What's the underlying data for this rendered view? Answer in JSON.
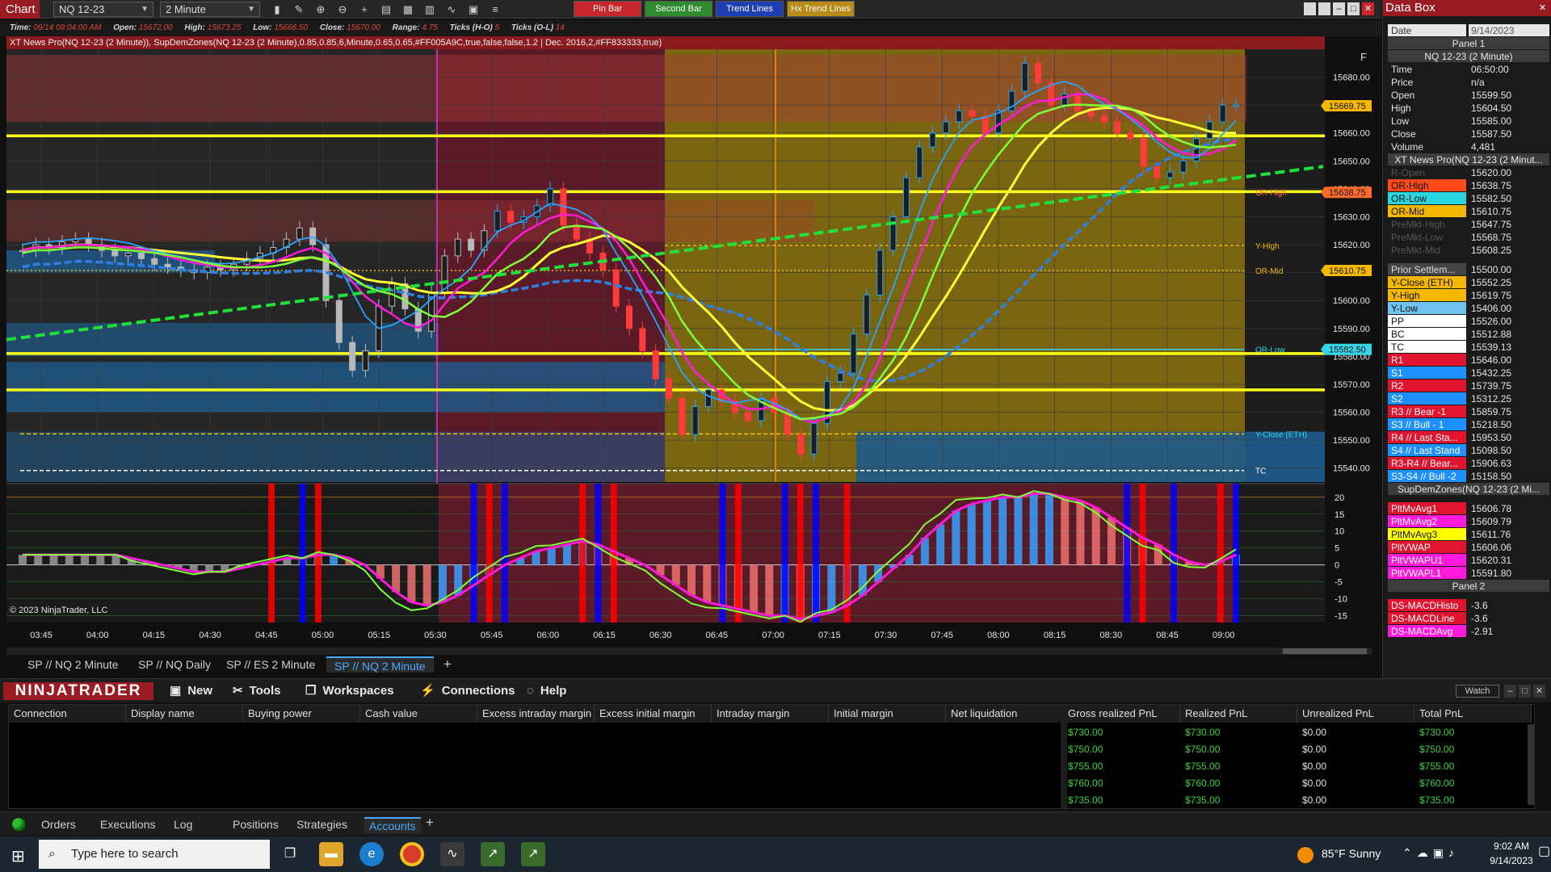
{
  "app": {
    "window_title": "Chart",
    "instrument": "NQ 12-23",
    "timeframe": "2 Minute",
    "copyright": "© 2023 NinjaTrader, LLC",
    "f_label": "F"
  },
  "highlight_buttons": [
    {
      "label": "Pin Bar",
      "color": "#c8262a"
    },
    {
      "label": "Second Bar",
      "color": "#2e8b2e"
    },
    {
      "label": "Trend Lines",
      "color": "#1d3fb3"
    },
    {
      "label": "Hx Trend Lines",
      "color": "#b88a18"
    }
  ],
  "info": {
    "time_label": "Time:",
    "time": "09/14 09:04:00 AM",
    "open_label": "Open:",
    "open": "15672.00",
    "high_label": "High:",
    "high": "15673.25",
    "low_label": "Low:",
    "low": "15668.50",
    "close_label": "Close:",
    "close": "15670.00",
    "range_label": "Range:",
    "range": "4.75",
    "ticks_hl_label": "Ticks (H-O)",
    "ticks_hl": "5",
    "ticks_ol_label": "Ticks (O-L)",
    "ticks_ol": "14"
  },
  "indicator_line": "XT News Pro(NQ 12-23 (2 Minute)), SupDemZones(NQ 12-23 (2 Minute),0.85,0.85,6,Minute,0.65,0.65,#FF005A9C,true,false,false,1.2 | Dec. 2016,2,#FF833333,true)",
  "price_axis": {
    "ticks": [
      "15680.00",
      "15670.00",
      "15660.00",
      "15650.00",
      "15640.00",
      "15630.00",
      "15620.00",
      "15610.00",
      "15600.00",
      "15590.00",
      "15580.00",
      "15570.00",
      "15560.00",
      "15550.00",
      "15540.00"
    ]
  },
  "price_markers": [
    {
      "value": "15669.75",
      "color": "#f5b800"
    },
    {
      "value": "15638.75",
      "color": "#ff6a2a"
    },
    {
      "value": "15610.75",
      "color": "#f5b800"
    },
    {
      "value": "15582.50",
      "color": "#34d6e6"
    }
  ],
  "level_labels": [
    "OR-High",
    "Y-High",
    "OR-Mid",
    "OR-Low",
    "Y-Close (ETH)",
    "TC"
  ],
  "macd_axis": {
    "ticks": [
      "20",
      "15",
      "10",
      "5",
      "0",
      "-5",
      "-10",
      "-15"
    ]
  },
  "time_axis": {
    "ticks": [
      "03:45",
      "04:00",
      "04:15",
      "04:30",
      "04:45",
      "05:00",
      "05:15",
      "05:30",
      "05:45",
      "06:00",
      "06:15",
      "06:30",
      "06:45",
      "07:00",
      "07:15",
      "07:30",
      "07:45",
      "08:00",
      "08:15",
      "08:30",
      "08:45",
      "09:00"
    ]
  },
  "chart_tabs": [
    {
      "label": "SP // NQ  2 Minute",
      "active": false
    },
    {
      "label": "SP // NQ  Daily",
      "active": false
    },
    {
      "label": "SP // ES  2 Minute",
      "active": false
    },
    {
      "label": "SP // NQ  2 Minute",
      "active": true
    }
  ],
  "add_tab": "+",
  "databox": {
    "title": "Data Box",
    "date_label": "Date",
    "date": "9/14/2023",
    "rows": [
      {
        "t": "sec",
        "k": "Panel 1"
      },
      {
        "t": "sec",
        "k": "NQ 12-23 (2 Minute)"
      },
      {
        "k": "Time",
        "v": "06:50:00",
        "bg": ""
      },
      {
        "k": "Price",
        "v": "n/a",
        "bg": ""
      },
      {
        "k": "Open",
        "v": "15599.50",
        "bg": ""
      },
      {
        "k": "High",
        "v": "15604.50",
        "bg": ""
      },
      {
        "k": "Low",
        "v": "15585.00",
        "bg": ""
      },
      {
        "k": "Close",
        "v": "15587.50",
        "bg": ""
      },
      {
        "k": "Volume",
        "v": "4,481",
        "bg": ""
      },
      {
        "t": "sec",
        "k": "XT News Pro(NQ 12-23 (2 Minut..."
      },
      {
        "k": "R-Open",
        "v": "15620.00",
        "bg": "#1a1a1a",
        "fg": "#555"
      },
      {
        "k": "OR-High",
        "v": "15638.75",
        "bg": "#ff4a1a",
        "fg": "#111"
      },
      {
        "k": "OR-Low",
        "v": "15582.50",
        "bg": "#2ad6e0",
        "fg": "#111"
      },
      {
        "k": "OR-Mid",
        "v": "15610.75",
        "bg": "#f5b800",
        "fg": "#111"
      },
      {
        "k": "PreMkt-High",
        "v": "15647.75",
        "bg": "#1a1a1a",
        "fg": "#555"
      },
      {
        "k": "PreMkt-Low",
        "v": "15568.75",
        "bg": "#1a1a1a",
        "fg": "#555"
      },
      {
        "k": "PreMkt-Mid",
        "v": "15608.25",
        "bg": "#1a1a1a",
        "fg": "#555"
      },
      {
        "t": "gap"
      },
      {
        "k": "Prior Settlem...",
        "v": "15500.00",
        "bg": "#444",
        "fg": "#ddd"
      },
      {
        "k": "Y-Close (ETH)",
        "v": "15552.25",
        "bg": "#f5b800",
        "fg": "#111"
      },
      {
        "k": "Y-High",
        "v": "15619.75",
        "bg": "#f5b800",
        "fg": "#111"
      },
      {
        "k": "Y-Low",
        "v": "15406.00",
        "bg": "#6fc3ef",
        "fg": "#111"
      },
      {
        "k": "PP",
        "v": "15526.00",
        "bg": "#ffffff",
        "fg": "#111"
      },
      {
        "k": "BC",
        "v": "15512.88",
        "bg": "#ffffff",
        "fg": "#111"
      },
      {
        "k": "TC",
        "v": "15539.13",
        "bg": "#ffffff",
        "fg": "#111"
      },
      {
        "k": "R1",
        "v": "15646.00",
        "bg": "#e0142e",
        "fg": "#fff"
      },
      {
        "k": "S1",
        "v": "15432.25",
        "bg": "#1e90ff",
        "fg": "#fff"
      },
      {
        "k": "R2",
        "v": "15739.75",
        "bg": "#e0142e",
        "fg": "#fff"
      },
      {
        "k": "S2",
        "v": "15312.25",
        "bg": "#1e90ff",
        "fg": "#fff"
      },
      {
        "k": "R3 // Bear -1",
        "v": "15859.75",
        "bg": "#e0142e",
        "fg": "#fff"
      },
      {
        "k": "S3 // Bull - 1",
        "v": "15218.50",
        "bg": "#1e90ff",
        "fg": "#fff"
      },
      {
        "k": "R4 // Last Sta...",
        "v": "15953.50",
        "bg": "#e0142e",
        "fg": "#fff"
      },
      {
        "k": "S4 // Last Stand",
        "v": "15098.50",
        "bg": "#1e90ff",
        "fg": "#fff"
      },
      {
        "k": "R3-R4 // Bear...",
        "v": "15906.63",
        "bg": "#e0142e",
        "fg": "#fff"
      },
      {
        "k": "S3-S4 // Bull -2",
        "v": "15158.50",
        "bg": "#1e90ff",
        "fg": "#fff"
      },
      {
        "t": "sec",
        "k": "SupDemZones(NQ 12-23 (2 Mi..."
      },
      {
        "t": "gap"
      },
      {
        "k": "PltMvAvg1",
        "v": "15606.78",
        "bg": "#e0142e",
        "fg": "#fff"
      },
      {
        "k": "PltMvAvg2",
        "v": "15609.79",
        "bg": "#ff1ad9",
        "fg": "#fff"
      },
      {
        "k": "PltMvAvg3",
        "v": "15611.76",
        "bg": "#ffff00",
        "fg": "#111"
      },
      {
        "k": "PltVWAP",
        "v": "15606.06",
        "bg": "#e0142e",
        "fg": "#fff"
      },
      {
        "k": "PltVWAPU1",
        "v": "15620.31",
        "bg": "#ff1ad9",
        "fg": "#fff"
      },
      {
        "k": "PltVWAPL1",
        "v": "15591.80",
        "bg": "#ff1ad9",
        "fg": "#fff"
      },
      {
        "t": "sec",
        "k": "Panel 2"
      },
      {
        "t": "gap"
      },
      {
        "k": "DS-MACDHisto",
        "v": "-3.6",
        "bg": "#e0142e",
        "fg": "#fff"
      },
      {
        "k": "DS-MACDLine",
        "v": "-3.6",
        "bg": "#e0142e",
        "fg": "#fff"
      },
      {
        "k": "DS-MACDAvg",
        "v": "-2.91",
        "bg": "#ff1ad9",
        "fg": "#fff"
      }
    ]
  },
  "nt": {
    "logo": "NINJATRADER",
    "menu": [
      {
        "label": "New",
        "icon": "new-window-icon",
        "glyph": "▣"
      },
      {
        "label": "Tools",
        "icon": "tools-icon",
        "glyph": "✂"
      },
      {
        "label": "Workspaces",
        "icon": "workspaces-icon",
        "glyph": "❐"
      },
      {
        "label": "Connections",
        "icon": "connections-icon",
        "glyph": "⚡"
      },
      {
        "label": "Help",
        "icon": "help-icon",
        "glyph": "◌"
      }
    ],
    "watch": "Watch"
  },
  "accounts": {
    "columns": [
      "Connection",
      "Display name",
      "Buying power",
      "Cash value",
      "Excess intraday margin",
      "Excess initial margin",
      "Intraday margin",
      "Initial margin",
      "Net liquidation",
      "Gross realized PnL",
      "Realized PnL",
      "Unrealized PnL",
      "Total PnL"
    ],
    "rows": [
      [
        "$730.00",
        "$730.00",
        "$0.00",
        "$730.00"
      ],
      [
        "$750.00",
        "$750.00",
        "$0.00",
        "$750.00"
      ],
      [
        "$755.00",
        "$755.00",
        "$0.00",
        "$755.00"
      ],
      [
        "$760.00",
        "$760.00",
        "$0.00",
        "$760.00"
      ],
      [
        "$735.00",
        "$735.00",
        "$0.00",
        "$735.00"
      ]
    ]
  },
  "bottom_tabs": [
    {
      "label": "Orders",
      "active": false
    },
    {
      "label": "Executions",
      "active": false
    },
    {
      "label": "Log",
      "active": false
    },
    {
      "label": "Positions",
      "active": false
    },
    {
      "label": "Strategies",
      "active": false
    },
    {
      "label": "Accounts",
      "active": true
    }
  ],
  "taskbar": {
    "search_placeholder": "Type here to search",
    "weather": "85°F  Sunny",
    "time": "9:02 AM",
    "date": "9/14/2023"
  },
  "chart_data": {
    "type": "candlestick",
    "y_range": [
      15535,
      15690
    ],
    "y_ticks": [
      15680,
      15670,
      15660,
      15650,
      15640,
      15630,
      15620,
      15610,
      15600,
      15590,
      15580,
      15570,
      15560,
      15550,
      15540
    ],
    "x_ticks": [
      "03:45",
      "04:00",
      "04:15",
      "04:30",
      "04:45",
      "05:00",
      "05:15",
      "05:30",
      "05:45",
      "06:00",
      "06:15",
      "06:30",
      "06:45",
      "07:00",
      "07:15",
      "07:30",
      "07:45",
      "08:00",
      "08:15",
      "08:30",
      "08:45",
      "09:00"
    ],
    "levels": [
      {
        "name": "OR-High",
        "value": 15638.75
      },
      {
        "name": "Y-High",
        "value": 15619.75
      },
      {
        "name": "OR-Mid",
        "value": 15610.75
      },
      {
        "name": "OR-Low",
        "value": 15582.5
      },
      {
        "name": "Y-Close (ETH)",
        "value": 15552.25
      },
      {
        "name": "TC",
        "value": 15539.13
      }
    ],
    "yellow_lines": [
      15659,
      15639,
      15581,
      15568
    ],
    "price_path": [
      15618,
      15620,
      15619,
      15621,
      15622,
      15620,
      15618,
      15616,
      15617,
      15615,
      15613,
      15612,
      15611,
      15610,
      15612,
      15611,
      15613,
      15615,
      15617,
      15619,
      15622,
      15626,
      15620,
      15600,
      15585,
      15575,
      15582,
      15598,
      15606,
      15597,
      15589,
      15603,
      15616,
      15622,
      15618,
      15625,
      15632,
      15628,
      15630,
      15634,
      15640,
      15627,
      15622,
      15617,
      15611,
      15598,
      15590,
      15582,
      15572,
      15565,
      15552,
      15562,
      15568,
      15564,
      15560,
      15557,
      15565,
      15560,
      15552,
      15545,
      15556,
      15571,
      15574,
      15588,
      15602,
      15618,
      15630,
      15644,
      15655,
      15660,
      15664,
      15668,
      15666,
      15660,
      15668,
      15675,
      15685,
      15678,
      15670,
      15674,
      15668,
      15666,
      15664,
      15660,
      15658,
      15648,
      15644,
      15646,
      15650,
      15658,
      15664,
      15670,
      15670
    ],
    "macd_range": [
      -17,
      24
    ],
    "macd_ticks": [
      20,
      15,
      10,
      5,
      0,
      -5,
      -10,
      -15
    ],
    "macd": [
      3,
      3,
      3,
      3,
      3,
      3,
      3,
      2,
      1,
      0,
      -1,
      -2,
      -2,
      -2,
      -1,
      0,
      1,
      2,
      2,
      3,
      3,
      2,
      0,
      -4,
      -8,
      -11,
      -12,
      -11,
      -9,
      -6,
      -3,
      0,
      2,
      4,
      5,
      6,
      7,
      6,
      4,
      2,
      0,
      -3,
      -6,
      -9,
      -11,
      -12,
      -13,
      -14,
      -15,
      -15,
      -16,
      -15,
      -14,
      -12,
      -9,
      -5,
      -1,
      3,
      8,
      12,
      16,
      18,
      19,
      20,
      20,
      21,
      21,
      20,
      19,
      17,
      14,
      11,
      8,
      6,
      3,
      1,
      0,
      1,
      3
    ]
  }
}
